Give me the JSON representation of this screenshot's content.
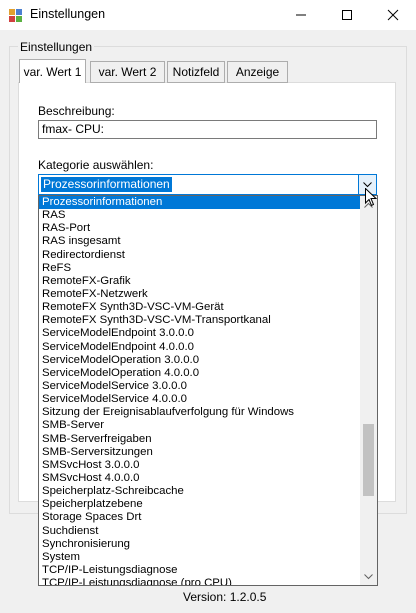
{
  "window": {
    "title": "Einstellungen"
  },
  "group": {
    "label": "Einstellungen"
  },
  "tabs": [
    {
      "label": "var. Wert 1"
    },
    {
      "label": "var. Wert 2"
    },
    {
      "label": "Notizfeld"
    },
    {
      "label": "Anzeige"
    }
  ],
  "description": {
    "label": "Beschreibung:",
    "value": "fmax- CPU:"
  },
  "category": {
    "label": "Kategorie auswählen:",
    "selected": "Prozessorinformationen",
    "options": [
      "Prozessorinformationen",
      "RAS",
      "RAS-Port",
      "RAS insgesamt",
      "Redirectordienst",
      "ReFS",
      "RemoteFX-Grafik",
      "RemoteFX-Netzwerk",
      "RemoteFX Synth3D-VSC-VM-Gerät",
      "RemoteFX Synth3D-VSC-VM-Transportkanal",
      "ServiceModelEndpoint 3.0.0.0",
      "ServiceModelEndpoint 4.0.0.0",
      "ServiceModelOperation 3.0.0.0",
      "ServiceModelOperation 4.0.0.0",
      "ServiceModelService 3.0.0.0",
      "ServiceModelService 4.0.0.0",
      "Sitzung der Ereignisablaufverfolgung für Windows",
      "SMB-Server",
      "SMB-Serverfreigaben",
      "SMB-Serversitzungen",
      "SMSvcHost 3.0.0.0",
      "SMSvcHost 4.0.0.0",
      "Speicherplatz-Schreibcache",
      "Speicherplatzebene",
      "Storage Spaces Drt",
      "Suchdienst",
      "Synchronisierung",
      "System",
      "TCP/IP-Leistungsdiagnose",
      "TCP/IP-Leistungsdiagnose (pro CPU)"
    ]
  },
  "footer": {
    "version": "Version: 1.2.0.5"
  },
  "colors": {
    "accent": "#0078d7",
    "window_bg": "#f0f0f0"
  }
}
